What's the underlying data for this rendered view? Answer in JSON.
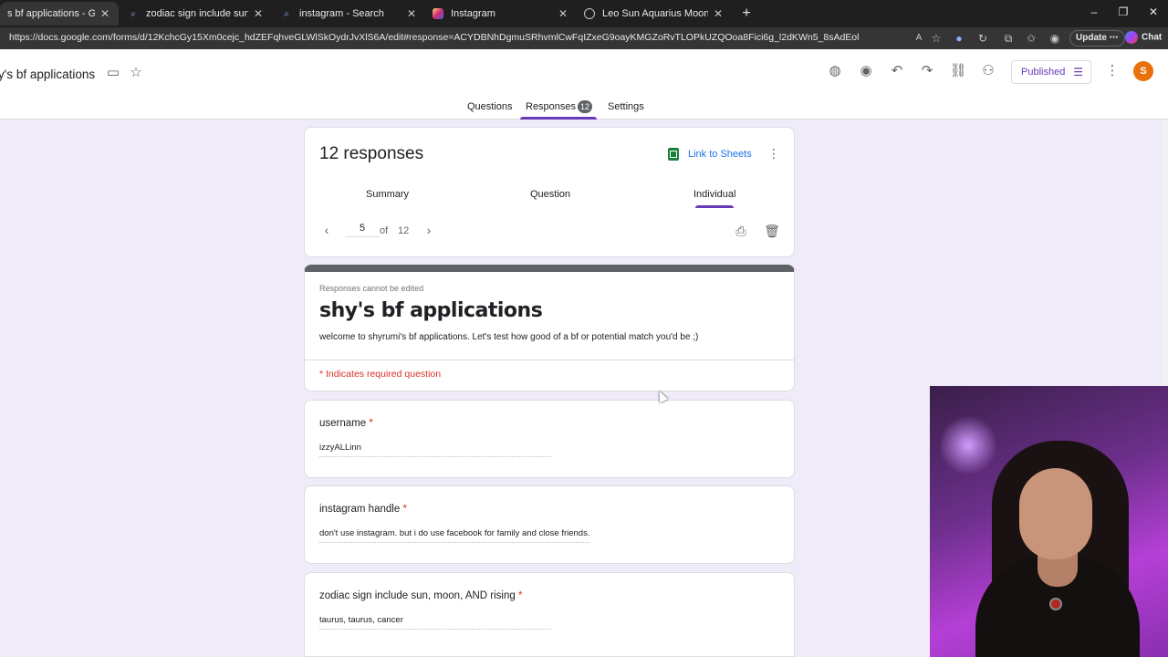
{
  "browser": {
    "tabs": [
      {
        "title": "s bf applications - Google Forms",
        "icon": "forms-icon",
        "active": true
      },
      {
        "title": "zodiac sign include sun, moon, AN",
        "icon": "search-icon",
        "active": false
      },
      {
        "title": "instagram - Search",
        "icon": "search-icon",
        "active": false
      },
      {
        "title": "Instagram",
        "icon": "instagram-icon",
        "active": false
      },
      {
        "title": "Leo Sun Aquarius Moon",
        "icon": "globe-icon",
        "active": false
      }
    ],
    "url": "https://docs.google.com/forms/d/12KchcGy15Xm0cejc_hdZEFqhveGLWlSkOydrJvXlS6A/edit#response=ACYDBNhDgmuSRhvmlCwFqIZxeG9oayKMGZoRvTLOPkUZQOoa8Fici6g_l2dKWn5_8sAdEol",
    "update_label": "Update",
    "chat_label": "Chat"
  },
  "form_header": {
    "title": "y's bf applications",
    "published_label": "Published",
    "avatar_initial": "S",
    "tabs": {
      "questions": "Questions",
      "responses": "Responses",
      "settings": "Settings"
    },
    "response_count_badge": "12"
  },
  "responses_card": {
    "title": "12 responses",
    "link_to_sheets": "Link to Sheets",
    "subtabs": {
      "summary": "Summary",
      "question": "Question",
      "individual": "Individual"
    }
  },
  "pager": {
    "current": "5",
    "of_label": "of",
    "total": "12"
  },
  "form": {
    "note": "Responses cannot be edited",
    "name": "shy's bf applications",
    "description": "welcome to shyrumi's bf applications. Let's test how good of a bf or potential match you'd be ;)",
    "required_note": "* Indicates required question"
  },
  "questions": [
    {
      "label": "username",
      "required_mark": "*",
      "answer": "izzyALLinn"
    },
    {
      "label": "instagram handle",
      "required_mark": "*",
      "answer": "don't use instagram. but i do use facebook for family and close friends."
    },
    {
      "label": "zodiac sign include sun, moon, AND rising",
      "required_mark": "*",
      "answer": "taurus, taurus, cancer"
    }
  ],
  "colors": {
    "accent": "#673ab7",
    "required": "#d93025",
    "link": "#1a73e8",
    "background": "#f0ebf8"
  }
}
